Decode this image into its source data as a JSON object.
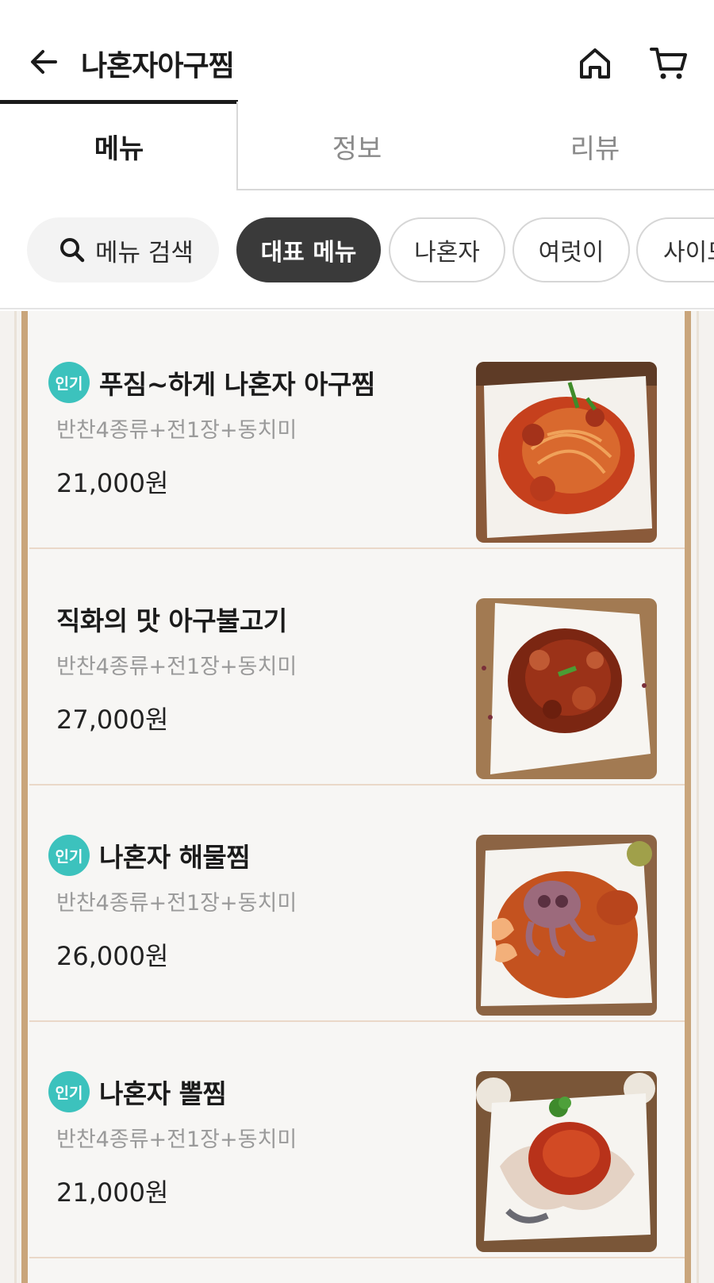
{
  "header": {
    "title": "나혼자아구찜"
  },
  "tabs": [
    {
      "label": "메뉴",
      "active": true
    },
    {
      "label": "정보",
      "active": false
    },
    {
      "label": "리뷰",
      "active": false
    }
  ],
  "search": {
    "label": "메뉴 검색"
  },
  "filters": [
    {
      "label": "대표 메뉴",
      "active": true
    },
    {
      "label": "나혼자",
      "active": false
    },
    {
      "label": "여럿이",
      "active": false
    },
    {
      "label": "사이드",
      "active": false
    }
  ],
  "menu": {
    "items": [
      {
        "badge": "인기",
        "name": "푸짐~하게 나혼자 아구찜",
        "desc": "반찬4종류+전1장+동치미",
        "price": "21,000원"
      },
      {
        "badge": "",
        "name": "직화의 맛 아구불고기",
        "desc": "반찬4종류+전1장+동치미",
        "price": "27,000원"
      },
      {
        "badge": "인기",
        "name": "나혼자 해물찜",
        "desc": "반찬4종류+전1장+동치미",
        "price": "26,000원"
      },
      {
        "badge": "인기",
        "name": "나혼자 뽈찜",
        "desc": "반찬4종류+전1장+동치미",
        "price": "21,000원"
      }
    ]
  },
  "colors": {
    "badge": "#3cc2bd",
    "active_chip": "#3a3a3a",
    "rail": "#c9a57b"
  },
  "icons": {
    "back": "arrow-left-icon",
    "home": "home-icon",
    "cart": "cart-icon",
    "search": "search-icon"
  }
}
